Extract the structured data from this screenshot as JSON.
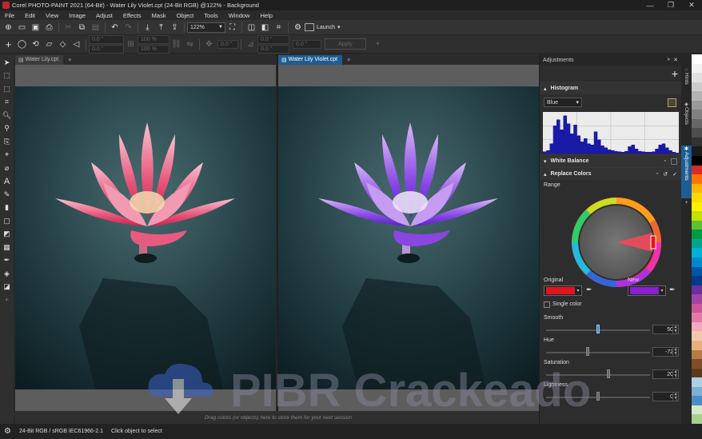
{
  "window": {
    "title": "Corel PHOTO-PAINT 2021 (64-Bit) - Water Lily Violet.cpt (24-Bit RGB) @122% - Background",
    "controls": [
      "—",
      "❐",
      "✕"
    ]
  },
  "menu": [
    "File",
    "Edit",
    "View",
    "Image",
    "Adjust",
    "Effects",
    "Mask",
    "Object",
    "Tools",
    "Window",
    "Help"
  ],
  "toolbar": {
    "zoom": "122%",
    "launch_label": "Launch"
  },
  "propertybar": {
    "fields": [
      "0.0 \"",
      "0.0 \"",
      "100 %",
      "100 %",
      "0.0 \"",
      "0.0 °",
      "0.0 \"",
      "0.0 \""
    ],
    "apply_label": "Apply"
  },
  "documents": [
    {
      "tab_label": "Water Lily.cpt",
      "active": false
    },
    {
      "tab_label": "Water Lily Violet.cpt",
      "active": true
    }
  ],
  "canvas_hint": "Drag colors (or objects) here to store them for your next session",
  "adjustments": {
    "panel_title": "Adjustments",
    "histogram": {
      "title": "Histogram",
      "channel": "Blue",
      "bins": [
        0.05,
        0.08,
        0.25,
        0.7,
        0.85,
        0.6,
        0.95,
        0.75,
        0.5,
        0.72,
        0.45,
        0.3,
        0.38,
        0.25,
        0.22,
        0.55,
        0.35,
        0.2,
        0.15,
        0.1,
        0.08,
        0.06,
        0.05,
        0.04,
        0.06,
        0.18,
        0.22,
        0.12,
        0.06,
        0.05,
        0.04,
        0.04,
        0.05,
        0.12,
        0.22,
        0.25,
        0.15,
        0.08,
        0.04,
        0.02
      ]
    },
    "white_balance": {
      "title": "White Balance"
    },
    "replace_colors": {
      "title": "Replace Colors",
      "range_label": "Range",
      "original_label": "Original",
      "new_label": "New",
      "original_color": "#e0141f",
      "new_color": "#8a1fd1",
      "single_color_label": "Single color",
      "smooth": {
        "label": "Smooth",
        "value": "50",
        "fraction": 0.5
      },
      "hue": {
        "label": "Hue",
        "value": "-72",
        "fraction": 0.4
      },
      "saturation": {
        "label": "Saturation",
        "value": "20",
        "fraction": 0.6
      },
      "lightness": {
        "label": "Lightness",
        "value": "0",
        "fraction": 0.5
      }
    }
  },
  "side_tabs": [
    "Hints",
    "Objects",
    "Adjustments"
  ],
  "palette_colors": [
    "#ffffff",
    "#f2f2f2",
    "#e0e0e0",
    "#cccccc",
    "#b3b3b3",
    "#999999",
    "#808080",
    "#666666",
    "#4d4d4d",
    "#333333",
    "#1a1a1a",
    "#000000",
    "#d72a2a",
    "#ff7300",
    "#ffb400",
    "#ffd800",
    "#ffef00",
    "#c6e000",
    "#5fc132",
    "#009a44",
    "#00a58a",
    "#00b1d6",
    "#0088cc",
    "#0055aa",
    "#003a8c",
    "#6b2f9e",
    "#9d46a8",
    "#c9579a",
    "#e37aa6",
    "#f2a9bd",
    "#f5c9a8",
    "#e6b27a",
    "#b57c44",
    "#7d4f24",
    "#5e3b1b",
    "#b0cfe6",
    "#7eaed4",
    "#4a8dc2",
    "#d4e7c8",
    "#a7d08f"
  ],
  "status": {
    "color_mode": "24-Bit RGB / sRGB IEC61966-2.1",
    "hint": "Click object to select"
  },
  "watermark_text": "PIBR Crackeado"
}
